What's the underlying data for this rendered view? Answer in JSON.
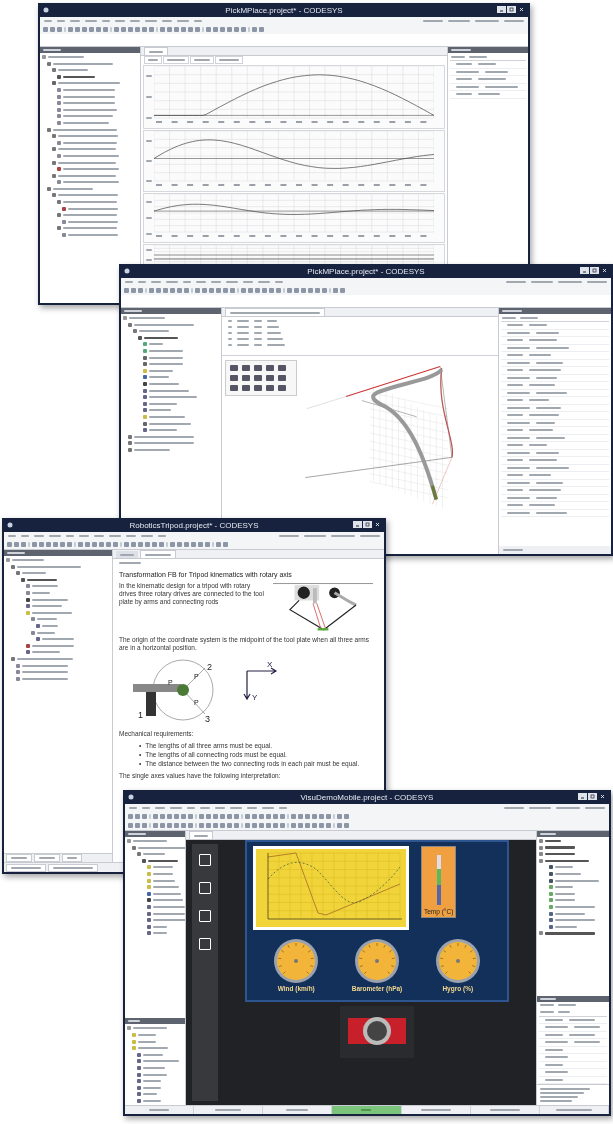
{
  "windows": [
    {
      "kind": "plots",
      "title": "PickMPlace.project* - CODESYS"
    },
    {
      "kind": "cam3d",
      "title": "PickMPlace.project* - CODESYS"
    },
    {
      "kind": "help",
      "title": "RoboticsTripod.project* - CODESYS",
      "heading": "Transformation FB for Tripod kinematics with rotary axis",
      "intro": "In the kinematic design for a tripod with rotary drives three rotary drives are connected to the tool plate by arms and connecting rods",
      "origin": "The origin of the coordinate system is the midpoint of the tool plate when all three arms are in a horizontal position.",
      "diagram": {
        "arm_1": "1",
        "arm_2": "2",
        "arm_3": "3",
        "points": [
          "P",
          "P",
          "P"
        ],
        "axis_x": "X",
        "axis_y": "Y"
      },
      "requirements_title": "Mechanical requirements:",
      "requirements": [
        {
          "marker": "•",
          "text": "The lengths of all three arms must be equal."
        },
        {
          "marker": "•",
          "text": "The lengths of all connecting rods must be equal."
        },
        {
          "marker": "•",
          "text": "The distance between the two connecting rods in each pair must be equal."
        }
      ],
      "axes_note": "The single axes values have the following interpretation:"
    },
    {
      "kind": "visu",
      "title": "VisuDemoMobile.project - CODESYS",
      "gauges": [
        "Wind (km/h)",
        "Barometer (hPa)",
        "Hygro (%)"
      ],
      "thermometer": "Temp (°C)"
    }
  ]
}
